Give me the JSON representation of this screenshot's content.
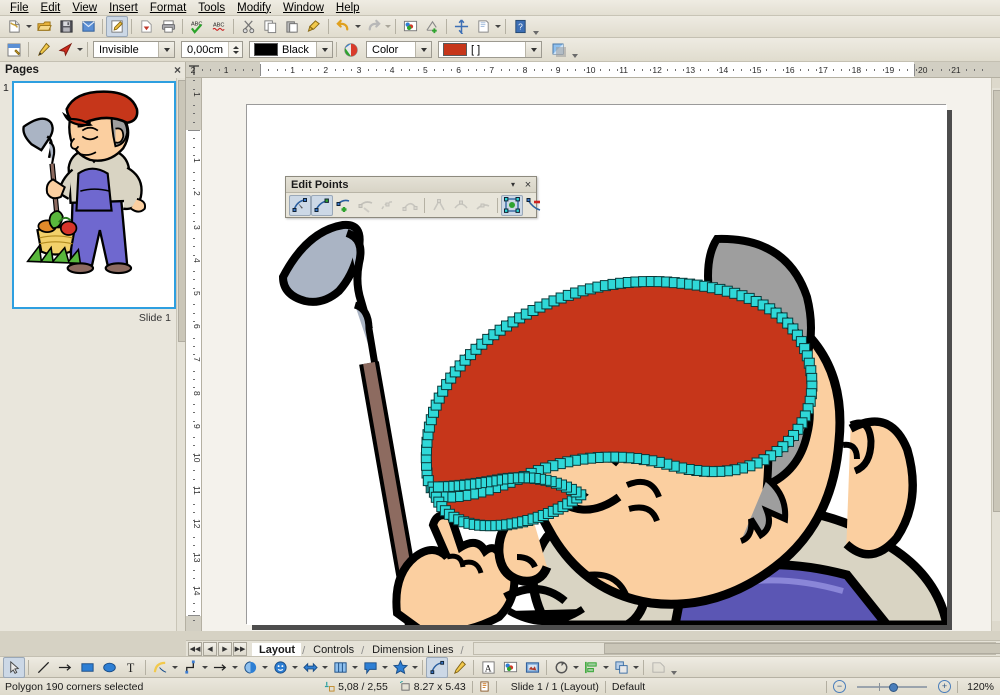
{
  "app": {
    "title": "Impress Draw Window"
  },
  "menubar": {
    "items": [
      {
        "label": "File"
      },
      {
        "label": "Edit"
      },
      {
        "label": "View"
      },
      {
        "label": "Insert"
      },
      {
        "label": "Format"
      },
      {
        "label": "Tools"
      },
      {
        "label": "Modify"
      },
      {
        "label": "Window"
      },
      {
        "label": "Help"
      }
    ]
  },
  "toolbar_standard": {
    "buttons": [
      {
        "name": "new-document-icon",
        "title": "New"
      },
      {
        "name": "open-document-icon",
        "title": "Open"
      },
      {
        "name": "save-document-icon",
        "title": "Save"
      },
      {
        "name": "email-document-icon",
        "title": "E-mail Document"
      },
      {
        "name": "edit-file-icon",
        "title": "Edit File"
      },
      {
        "name": "export-pdf-icon",
        "title": "Export as PDF"
      },
      {
        "name": "print-file-icon",
        "title": "Print File Directly"
      },
      {
        "name": "spelling-icon",
        "title": "Spelling and Grammar"
      },
      {
        "name": "autospellcheck-icon",
        "title": "AutoSpellcheck"
      },
      {
        "name": "cut-icon",
        "title": "Cut"
      },
      {
        "name": "copy-icon",
        "title": "Copy"
      },
      {
        "name": "paste-icon",
        "title": "Paste"
      },
      {
        "name": "clone-formatting-icon",
        "title": "Clone Formatting"
      },
      {
        "name": "undo-icon",
        "title": "Undo"
      },
      {
        "name": "redo-icon",
        "title": "Redo"
      },
      {
        "name": "insert-image-icon",
        "title": "Insert Image"
      },
      {
        "name": "insert-chart-icon",
        "title": "Insert Chart"
      },
      {
        "name": "display-grid-icon",
        "title": "Display Grid"
      },
      {
        "name": "display-views-icon",
        "title": "Display Views"
      },
      {
        "name": "help-icon",
        "title": "Help"
      }
    ]
  },
  "toolbar_line_fill": {
    "buttons": [
      {
        "name": "line-fill-style-icon",
        "title": "Line and Filling"
      },
      {
        "name": "line-color-pen-icon",
        "title": "Line Color"
      },
      {
        "name": "arrow-style-icon",
        "title": "Arrow Style"
      },
      {
        "name": "gradient-icon",
        "title": "Gradient"
      }
    ],
    "line_style": {
      "label": "Line Style",
      "value": "Invisible"
    },
    "line_width": {
      "label": "Line Width",
      "value": "0,00cm"
    },
    "line_color": {
      "label": "Line Color",
      "value": "Black",
      "swatch": "#000000"
    },
    "area_style": {
      "label": "Area Style / Filling",
      "value": "Color"
    },
    "area_fill": {
      "label": "Fill Color",
      "value": "[ ]",
      "swatch": "#c6361a"
    }
  },
  "pages_panel": {
    "title": "Pages",
    "close_label": "×",
    "slides": [
      {
        "number": "1",
        "caption": "Slide 1",
        "selected": true
      }
    ]
  },
  "ruler": {
    "horizontal": {
      "unit": "cm",
      "left_margin_labels": [
        "2",
        "1"
      ],
      "labels": [
        "1",
        "2",
        "3",
        "4",
        "5",
        "6",
        "7",
        "8",
        "9",
        "10",
        "11",
        "12",
        "13",
        "14",
        "15",
        "16",
        "17",
        "18",
        "19",
        "20",
        "21"
      ]
    },
    "vertical": {
      "unit": "cm",
      "top_margin_labels": [
        "1"
      ],
      "labels": [
        "1",
        "2",
        "3",
        "4",
        "5",
        "6",
        "7",
        "8",
        "9",
        "10",
        "11",
        "12",
        "13",
        "14",
        "15"
      ]
    }
  },
  "edit_points_toolbar": {
    "title": "Edit Points",
    "dropdown_label": "▾",
    "close_label": "×",
    "buttons": [
      {
        "name": "edit-points-icon",
        "title": "Edit Points",
        "state": "pressed"
      },
      {
        "name": "move-points-icon",
        "title": "Move Points",
        "state": "pressed"
      },
      {
        "name": "insert-points-icon",
        "title": "Insert Points",
        "state": "normal"
      },
      {
        "name": "delete-points-icon",
        "title": "Delete Points",
        "state": "disabled"
      },
      {
        "name": "split-curve-icon",
        "title": "Split Curve",
        "state": "disabled"
      },
      {
        "name": "convert-to-curve-icon",
        "title": "Convert to Curve",
        "state": "disabled"
      },
      {
        "name": "corner-point-icon",
        "title": "Corner Point",
        "state": "disabled"
      },
      {
        "name": "smooth-transition-icon",
        "title": "Smooth Transition",
        "state": "disabled"
      },
      {
        "name": "symmetric-transition-icon",
        "title": "Symmetric Transition",
        "state": "disabled"
      },
      {
        "name": "close-bezier-icon",
        "title": "Close Bezier",
        "state": "pressed"
      },
      {
        "name": "eliminate-points-icon",
        "title": "Eliminate Points",
        "state": "normal"
      }
    ]
  },
  "canvas": {
    "artwork_name": "gardener-with-hoe-clipart",
    "selected_object": "red-beret",
    "selection_handle_color": "#2fd8d8",
    "colors": {
      "beret_red": "#c6361a",
      "skin": "#fbcfa0",
      "hair_gray": "#9e9e9e",
      "shirt": "#d9d4c3",
      "overalls": "#5b56b4",
      "hoe_blade": "#aab4c4",
      "hoe_handle": "#8d6b60",
      "outline": "#000000"
    }
  },
  "tabbar": {
    "nav": [
      "❘◀",
      "◀",
      "▶",
      "▶❘"
    ],
    "tabs": [
      {
        "label": "Layout",
        "active": true
      },
      {
        "label": "Controls",
        "active": false
      },
      {
        "label": "Dimension Lines",
        "active": false
      }
    ]
  },
  "drawing_toolbar": {
    "buttons": [
      {
        "name": "select-tool-icon",
        "title": "Select",
        "state": "pressed"
      },
      {
        "name": "line-tool-icon",
        "title": "Insert Line"
      },
      {
        "name": "line-ends-arrow-icon",
        "title": "Line Ends with Arrow"
      },
      {
        "name": "rectangle-tool-icon",
        "title": "Rectangle"
      },
      {
        "name": "ellipse-tool-icon",
        "title": "Ellipse"
      },
      {
        "name": "text-tool-icon",
        "title": "Insert Text Box"
      },
      {
        "name": "curve-tool-icon",
        "title": "Curve"
      },
      {
        "name": "connector-tool-icon",
        "title": "Connector"
      },
      {
        "name": "lines-arrows-icon",
        "title": "Lines and Arrows"
      },
      {
        "name": "basic-shapes-icon",
        "title": "Basic Shapes"
      },
      {
        "name": "symbol-shapes-icon",
        "title": "Symbol Shapes"
      },
      {
        "name": "block-arrows-icon",
        "title": "Block Arrows"
      },
      {
        "name": "flowchart-shapes-icon",
        "title": "Flowchart"
      },
      {
        "name": "callout-shapes-icon",
        "title": "Callouts"
      },
      {
        "name": "stars-shapes-icon",
        "title": "Stars"
      },
      {
        "name": "edit-points-tool-icon",
        "title": "Points",
        "state": "pressed"
      },
      {
        "name": "glue-points-icon",
        "title": "Glue Points"
      },
      {
        "name": "fontwork-icon",
        "title": "Fontwork Gallery"
      },
      {
        "name": "from-file-icon",
        "title": "From File"
      },
      {
        "name": "gallery-icon",
        "title": "Gallery"
      },
      {
        "name": "rotate-icon",
        "title": "Rotate"
      },
      {
        "name": "align-icon",
        "title": "Alignment"
      },
      {
        "name": "arrange-icon",
        "title": "Arrange"
      },
      {
        "name": "shadow-icon",
        "title": "Shadow"
      }
    ]
  },
  "statusbar": {
    "message": "Polygon 190 corners selected",
    "cursor_position": "5,08 / 2,55",
    "object_size": "8.27 x 5.43",
    "slide_info": "Slide 1 / 1 (Layout)",
    "master_name": "Default",
    "zoom_value": "120%",
    "zoom_out_label": "−",
    "zoom_in_label": "+"
  }
}
